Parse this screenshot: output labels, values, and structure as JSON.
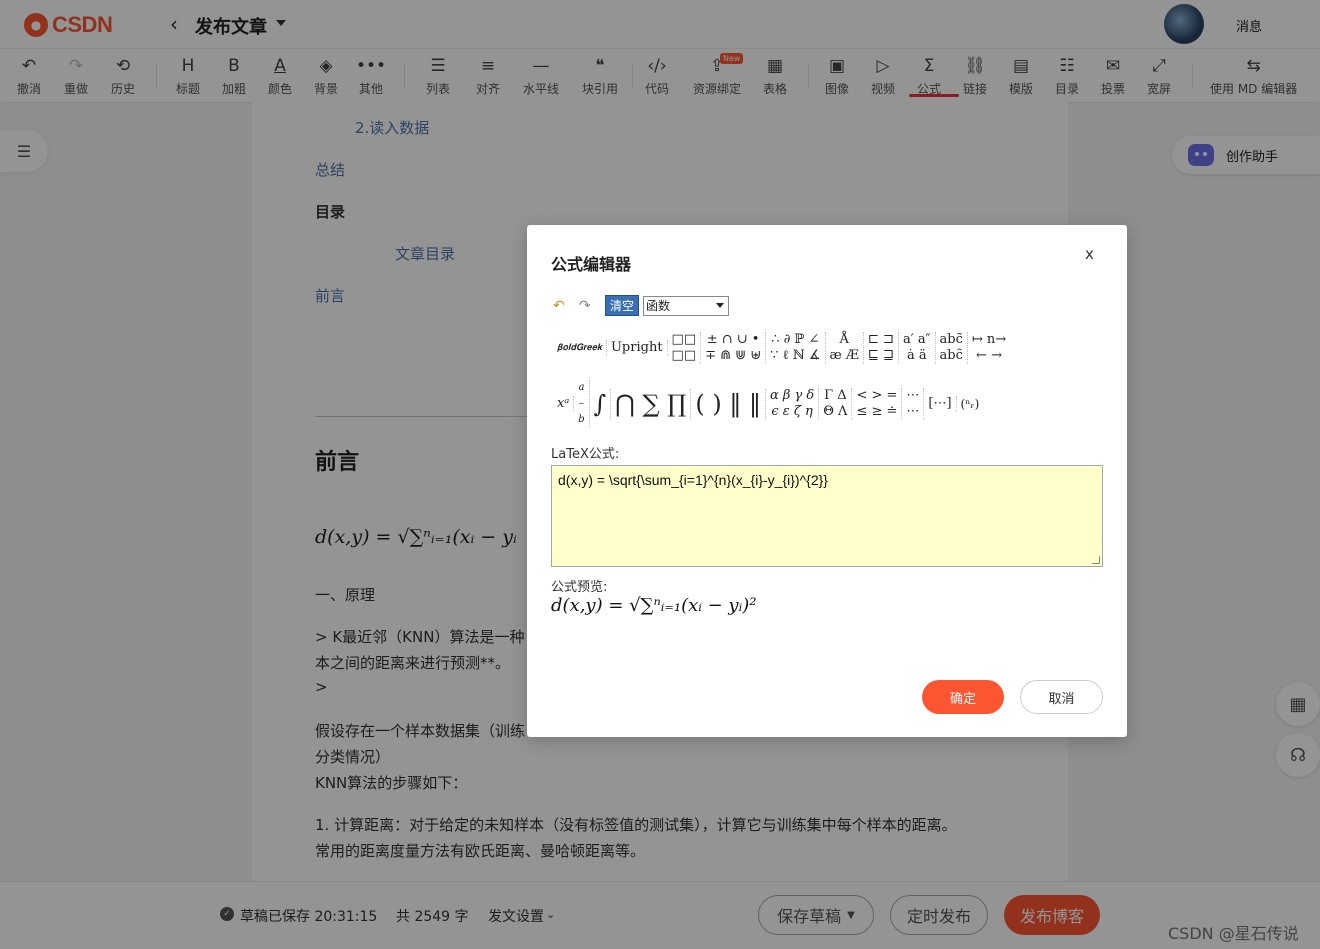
{
  "header": {
    "logo_text": "CSDN",
    "page_title": "发布文章",
    "messages_label": "消息"
  },
  "toolbar": {
    "items": [
      {
        "id": "undo",
        "label": "撤消",
        "icon": "↶"
      },
      {
        "id": "redo",
        "label": "重做",
        "icon": "↷"
      },
      {
        "id": "history",
        "label": "历史",
        "icon": "⟲"
      },
      {
        "id": "heading",
        "label": "标题",
        "icon": "H"
      },
      {
        "id": "bold",
        "label": "加粗",
        "icon": "B"
      },
      {
        "id": "color",
        "label": "颜色",
        "icon": "A"
      },
      {
        "id": "background",
        "label": "背景",
        "icon": "◈"
      },
      {
        "id": "more",
        "label": "其他",
        "icon": "•••"
      },
      {
        "id": "list",
        "label": "列表",
        "icon": "☰"
      },
      {
        "id": "align",
        "label": "对齐",
        "icon": "≡"
      },
      {
        "id": "hr",
        "label": "水平线",
        "icon": "—"
      },
      {
        "id": "quote",
        "label": "块引用",
        "icon": "❝"
      },
      {
        "id": "code",
        "label": "代码",
        "icon": "‹/›"
      },
      {
        "id": "resource",
        "label": "资源绑定",
        "icon": "⇪"
      },
      {
        "id": "table",
        "label": "表格",
        "icon": "▦"
      },
      {
        "id": "image",
        "label": "图像",
        "icon": "▣"
      },
      {
        "id": "video",
        "label": "视频",
        "icon": "▷"
      },
      {
        "id": "formula",
        "label": "公式",
        "icon": "Σ"
      },
      {
        "id": "link",
        "label": "链接",
        "icon": "⛓"
      },
      {
        "id": "template",
        "label": "模版",
        "icon": "▤"
      },
      {
        "id": "toc",
        "label": "目录",
        "icon": "☷"
      },
      {
        "id": "vote",
        "label": "投票",
        "icon": "✉"
      },
      {
        "id": "wide",
        "label": "宽屏",
        "icon": "⤢"
      },
      {
        "id": "md",
        "label": "使用 MD 编辑器",
        "icon": "⇆"
      }
    ],
    "new_badge": "New"
  },
  "doc": {
    "line1": "2.读入数据",
    "line2": "总结",
    "line3": "目录",
    "line4": "文章目录",
    "line5": "前言",
    "heading": "前言",
    "formula_partial": "d(x,y) = √∑ⁿᵢ₌₁(xᵢ − yᵢ",
    "p1": "一、原理",
    "p2a": "> K最近邻（KNN）算法是一种",
    "p2b": "本之间的距离来进行预测**。",
    "p2c": ">",
    "p3a": "假设存在一个样本数据集（训练",
    "p3b": "分类情况）",
    "p3c": "KNN算法的步骤如下：",
    "p4a": "1. 计算距离：对于给定的未知样本（没有标签值的测试集），计算它与训练集中每个样本的距离。",
    "p4b": "常用的距离度量方法有欧氏距离、曼哈顿距离等。"
  },
  "side": {
    "assistant_label": "创作助手"
  },
  "bottom": {
    "saved_status": "草稿已保存 20:31:15",
    "word_count": "共 2549 字",
    "settings": "发文设置",
    "save_draft": "保存草稿",
    "schedule": "定时发布",
    "publish": "发布博客",
    "watermark": "CSDN @星石传说"
  },
  "modal": {
    "title": "公式编辑器",
    "close": "x",
    "clear_label": "清空",
    "select_value": "函数",
    "latex_label": "LaTeX公式:",
    "latex_value": "d(x,y) = \\sqrt{\\sum_{i=1}^{n}(x_{i}-y_{i})^{2}}",
    "preview_label": "公式预览:",
    "preview_value": "d(x,y) = √∑ⁿᵢ₌₁(xᵢ − yᵢ)²",
    "ok_label": "确定",
    "cancel_label": "取消",
    "sym_bold_greek": "𝛃𝐨𝐥𝐝𝐆𝐫𝐞𝐞𝐤",
    "sym_upright": "Upright"
  }
}
